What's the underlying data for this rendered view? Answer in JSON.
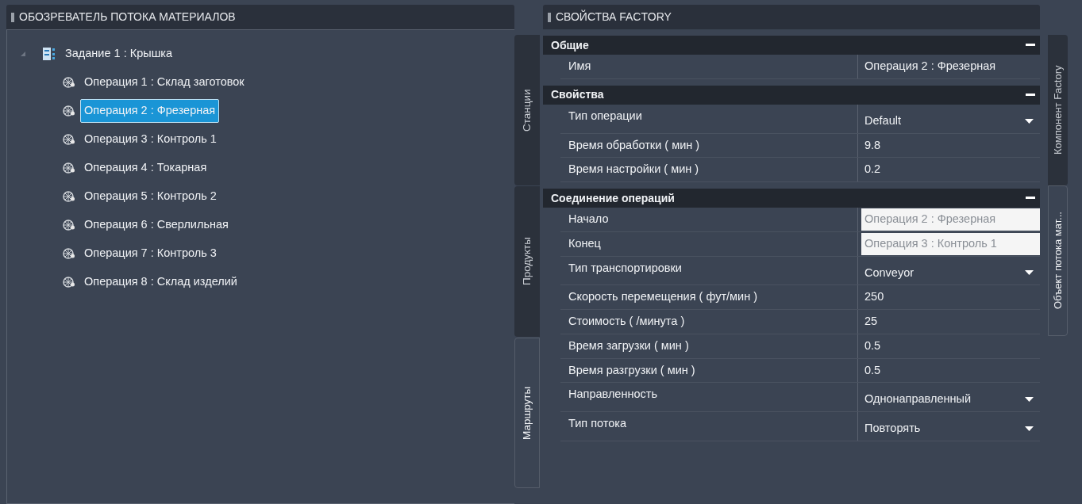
{
  "explorer": {
    "title": "ОБОЗРЕВАТЕЛЬ ПОТОКА МАТЕРИАЛОВ",
    "tree": [
      {
        "label": "Задание 1 : Крышка",
        "expanded": true,
        "selected": false,
        "children": [
          {
            "label": "Операция 1 : Склад заготовок",
            "selected": false
          },
          {
            "label": "Операция 2 : Фрезерная",
            "selected": true
          },
          {
            "label": "Операция 3 : Контроль 1",
            "selected": false
          },
          {
            "label": "Операция 4 : Токарная",
            "selected": false
          },
          {
            "label": "Операция 5 : Контроль 2",
            "selected": false
          },
          {
            "label": "Операция 6 : Сверлильная",
            "selected": false
          },
          {
            "label": "Операция 7 : Контроль 3",
            "selected": false
          },
          {
            "label": "Операция 8 : Склад изделий",
            "selected": false
          }
        ]
      }
    ]
  },
  "left_tabs": [
    {
      "label": "Станции",
      "selected": false
    },
    {
      "label": "Продукты",
      "selected": false
    },
    {
      "label": "Маршруты",
      "selected": true
    }
  ],
  "properties": {
    "title": "СВОЙСТВА FACTORY",
    "sections": [
      {
        "title": "Общие",
        "expanded": true,
        "rows": [
          {
            "kind": "text",
            "name": "Имя",
            "value": "Операция 2 : Фрезерная"
          }
        ]
      },
      {
        "title": "Свойства",
        "expanded": true,
        "rows": [
          {
            "kind": "dropdown",
            "name": "Тип операции",
            "value": "Default"
          },
          {
            "kind": "text",
            "name": "Время обработки ( мин )",
            "value": "9.8"
          },
          {
            "kind": "text",
            "name": "Время настройки ( мин )",
            "value": "0.2"
          }
        ]
      },
      {
        "title": "Соединение операций",
        "expanded": true,
        "rows": [
          {
            "kind": "readonly",
            "name": "Начало",
            "value": "Операция 2 : Фрезерная"
          },
          {
            "kind": "readonly",
            "name": "Конец",
            "value": "Операция 3 : Контроль 1"
          },
          {
            "kind": "dropdown",
            "name": "Тип транспортировки",
            "value": "Conveyor"
          },
          {
            "kind": "text",
            "name": "Скорость перемещения ( фут/мин )",
            "value": "250"
          },
          {
            "kind": "text",
            "name": "Стоимость ( /минута )",
            "value": "25"
          },
          {
            "kind": "text",
            "name": "Время загрузки ( мин )",
            "value": "0.5"
          },
          {
            "kind": "text",
            "name": "Время разгрузки ( мин )",
            "value": "0.5"
          },
          {
            "kind": "dropdown",
            "name": "Направленность",
            "value": "Однонаправленный"
          },
          {
            "kind": "dropdown",
            "name": "Тип потока",
            "value": "Повторять"
          }
        ]
      }
    ]
  },
  "right_tabs": [
    {
      "label": "Компонент Factory",
      "selected": false
    },
    {
      "label": "Объект потока мат...",
      "selected": true
    }
  ]
}
